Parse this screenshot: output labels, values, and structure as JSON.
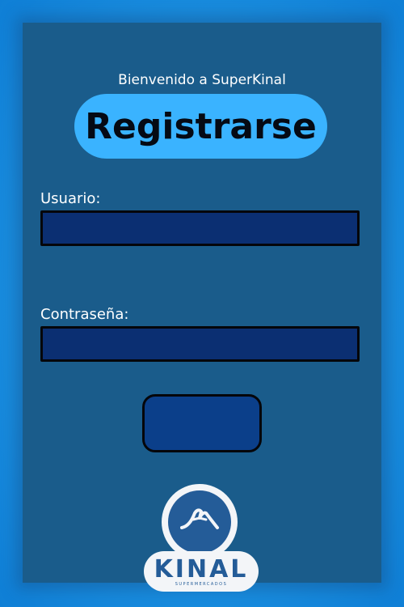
{
  "header": {
    "welcome": "Bienvenido a SuperKinal",
    "title": "Registrarse"
  },
  "form": {
    "username_label": "Usuario:",
    "username_value": "",
    "password_label": "Contraseña:",
    "password_value": "",
    "submit_label": ""
  },
  "logo": {
    "icon": "hands-roof-icon",
    "wordmark": "KINAL",
    "subtitle": "SUPERMERCADOS"
  },
  "colors": {
    "panel": "#1a5c8b",
    "accent_pill": "#3ab3ff",
    "field_bg": "#0b2f72",
    "button_bg": "#0b3f8a",
    "logo_blue": "#245c98"
  }
}
